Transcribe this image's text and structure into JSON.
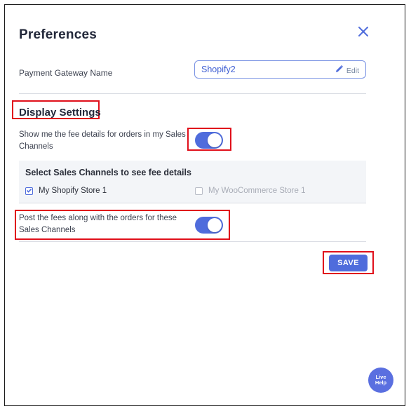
{
  "dialog": {
    "title": "Preferences",
    "close_icon": "close-icon"
  },
  "gateway": {
    "label": "Payment Gateway Name",
    "value": "Shopify2",
    "edit_label": "Edit",
    "edit_icon": "pencil-icon"
  },
  "display_settings": {
    "title": "Display Settings",
    "show_fees": {
      "text": "Show me the fee details for orders in my Sales Channels",
      "enabled": true
    },
    "channels": {
      "title": "Select Sales Channels to see fee details",
      "items": [
        {
          "label": "My Shopify Store 1",
          "checked": true
        },
        {
          "label": "My WooCommerce Store 1",
          "checked": false
        }
      ]
    },
    "post_fees": {
      "text": "Post the fees along with the orders for these Sales Channels",
      "enabled": true
    }
  },
  "actions": {
    "save_label": "SAVE"
  },
  "live_help": {
    "line1": "Live",
    "line2": "Help"
  },
  "colors": {
    "accent": "#4f6cdc",
    "highlight": "#e0101b"
  }
}
